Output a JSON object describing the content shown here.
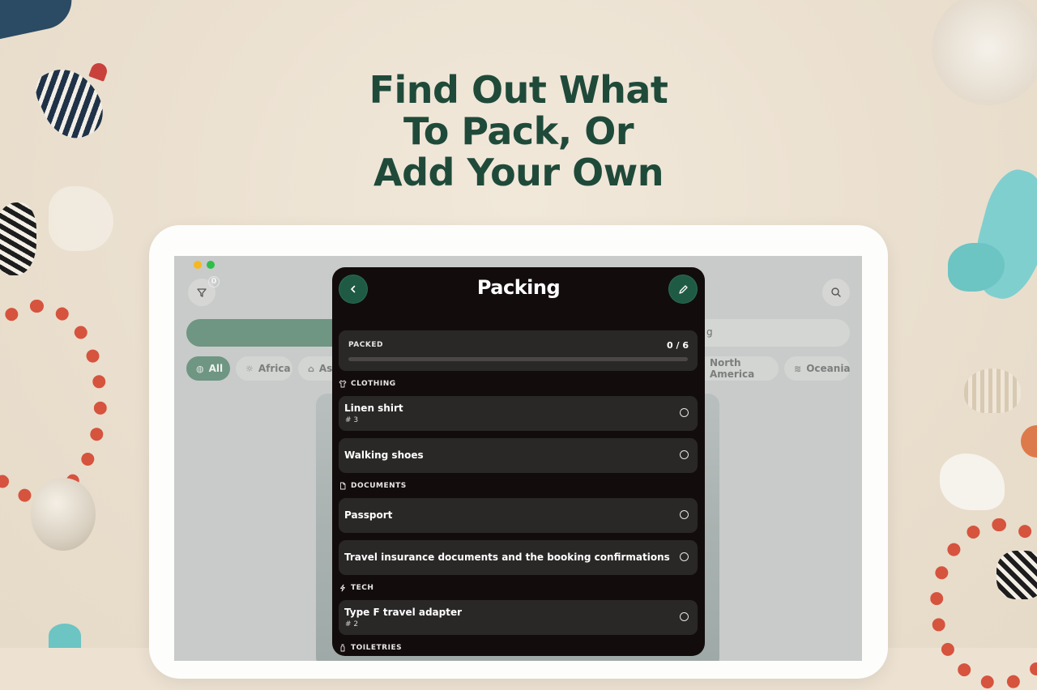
{
  "headline": [
    "Find Out What",
    "To Pack, Or",
    "Add Your Own"
  ],
  "background_app": {
    "filter_badge": "0",
    "search_hint": "g",
    "pills": [
      {
        "label": "All",
        "icon": "globe-icon",
        "active": true
      },
      {
        "label": "Africa",
        "icon": "sun-icon",
        "active": false
      },
      {
        "label": "As",
        "icon": "bank-icon",
        "active": false
      },
      {
        "label": "North America",
        "icon": "mountain-icon",
        "active": false
      },
      {
        "label": "Oceania",
        "icon": "wave-icon",
        "active": false
      }
    ]
  },
  "sheet": {
    "title": "Packing",
    "progress": {
      "label": "PACKED",
      "count": "0 / 6",
      "packed": 0,
      "total": 6
    },
    "sections": [
      {
        "name": "CLOTHING",
        "icon": "shirt-icon"
      },
      {
        "name": "DOCUMENTS",
        "icon": "document-icon"
      },
      {
        "name": "TECH",
        "icon": "bolt-icon"
      },
      {
        "name": "TOILETRIES",
        "icon": "bottle-icon"
      }
    ],
    "items": [
      {
        "name": "Linen shirt",
        "qty": "# 3"
      },
      {
        "name": "Walking shoes",
        "qty": ""
      },
      {
        "name": "Passport",
        "qty": ""
      },
      {
        "name": "Travel insurance documents and the booking confirmations",
        "qty": ""
      },
      {
        "name": "Type F travel adapter",
        "qty": "# 2"
      }
    ]
  },
  "colors": {
    "headline": "#1f4a3a",
    "accent_green": "#1f5a45",
    "sheet_bg": "#120d0c",
    "item_bg": "#2a2827"
  }
}
